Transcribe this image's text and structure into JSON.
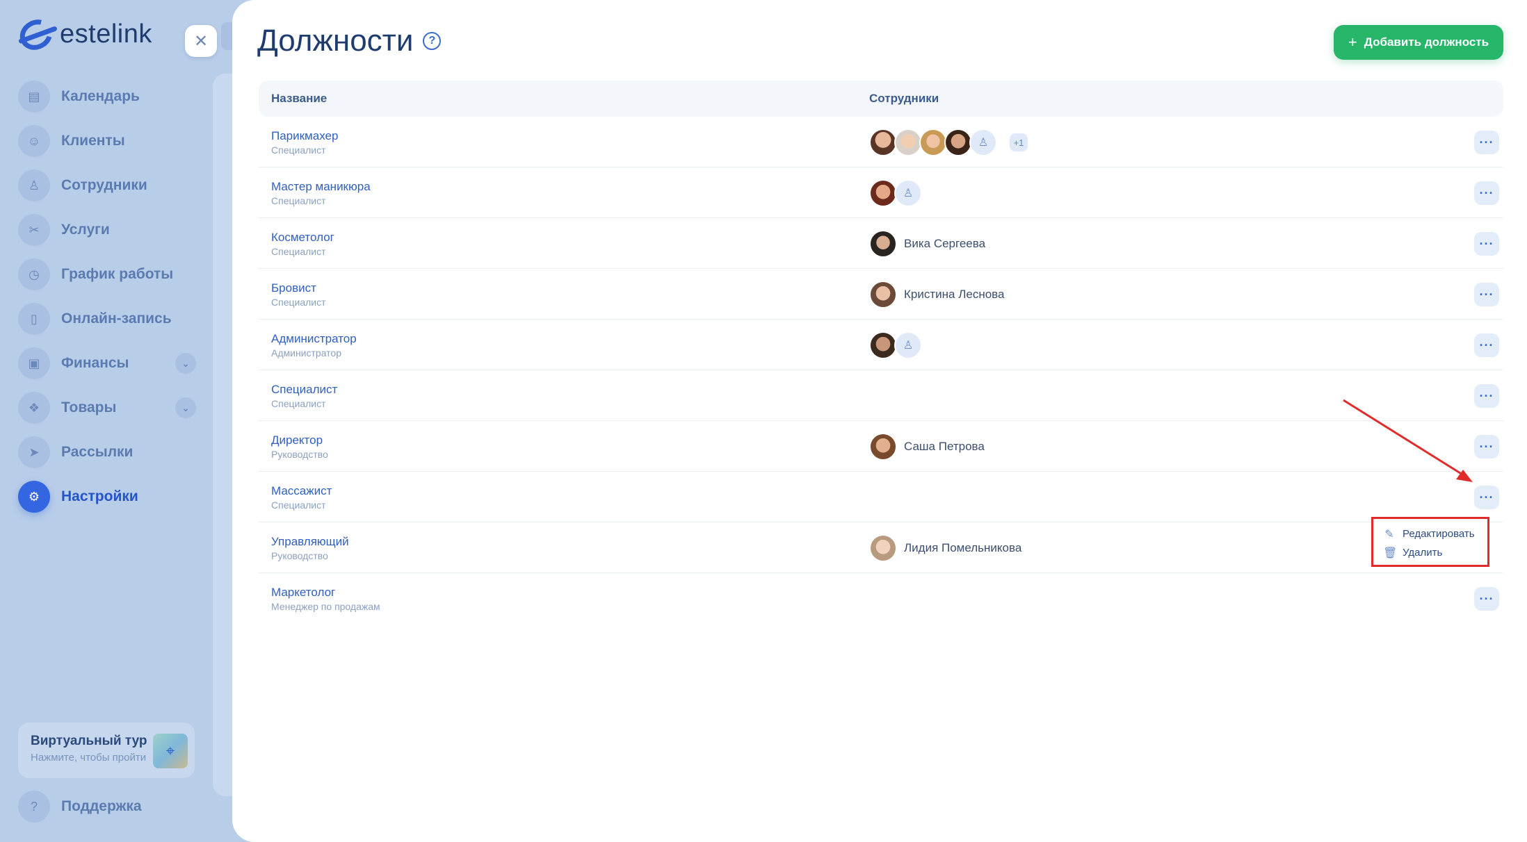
{
  "brand": {
    "name": "estelink"
  },
  "sidebar": {
    "items": [
      {
        "label": "Календарь",
        "icon": "calendar-icon"
      },
      {
        "label": "Клиенты",
        "icon": "clients-icon"
      },
      {
        "label": "Сотрудники",
        "icon": "user-icon"
      },
      {
        "label": "Услуги",
        "icon": "scissors-icon"
      },
      {
        "label": "График работы",
        "icon": "clock-icon"
      },
      {
        "label": "Онлайн-запись",
        "icon": "phone-icon"
      },
      {
        "label": "Финансы",
        "icon": "wallet-icon",
        "expandable": true
      },
      {
        "label": "Товары",
        "icon": "box-icon",
        "expandable": true
      },
      {
        "label": "Рассылки",
        "icon": "send-icon"
      },
      {
        "label": "Настройки",
        "icon": "gear-icon",
        "active": true
      }
    ],
    "tour": {
      "title": "Виртуальный тур",
      "subtitle": "Нажмите, чтобы пройти"
    },
    "support": "Поддержка"
  },
  "page": {
    "title": "Должности",
    "add_button": "Добавить должность"
  },
  "table": {
    "headers": {
      "name": "Название",
      "employees": "Сотрудники"
    },
    "rows": [
      {
        "title": "Парикмахер",
        "category": "Специалист",
        "employee": "",
        "extra": "+1"
      },
      {
        "title": "Мастер маникюра",
        "category": "Специалист",
        "employee": "",
        "extra": ""
      },
      {
        "title": "Косметолог",
        "category": "Специалист",
        "employee": "Вика Сергеева",
        "extra": ""
      },
      {
        "title": "Бровист",
        "category": "Специалист",
        "employee": "Кристина Леснова",
        "extra": ""
      },
      {
        "title": "Администратор",
        "category": "Администратор",
        "employee": "",
        "extra": ""
      },
      {
        "title": "Специалист",
        "category": "Специалист",
        "employee": "",
        "extra": ""
      },
      {
        "title": "Директор",
        "category": "Руководство",
        "employee": "Саша Петрова",
        "extra": ""
      },
      {
        "title": "Массажист",
        "category": "Специалист",
        "employee": "",
        "extra": ""
      },
      {
        "title": "Управляющий",
        "category": "Руководство",
        "employee": "Лидия Помельникова",
        "extra": ""
      },
      {
        "title": "Маркетолог",
        "category": "Менеджер по продажам",
        "employee": "",
        "extra": ""
      }
    ]
  },
  "dropdown": {
    "edit": "Редактировать",
    "delete": "Удалить"
  },
  "colors": {
    "accent": "#3366e0",
    "success": "#27b56a",
    "highlight": "#e02b2b"
  }
}
